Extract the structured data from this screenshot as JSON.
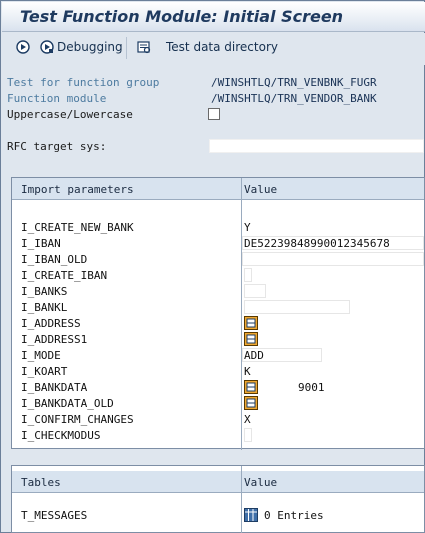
{
  "window": {
    "title": "Test Function Module: Initial Screen"
  },
  "toolbar": {
    "debugging_label": "Debugging",
    "testdata_label": "Test data directory"
  },
  "header_fields": {
    "function_group_label": "Test for function group",
    "function_group_value": "/WINSHTLQ/TRN_VENBNK_FUGR",
    "function_module_label": "Function module",
    "function_module_value": "/WINSHTLQ/TRN_VENDOR_BANK",
    "uppercase_label": "Uppercase/Lowercase",
    "rfc_label": "RFC target sys:"
  },
  "import_table": {
    "col_name": "Import parameters",
    "col_value": "Value",
    "rows": [
      {
        "name": "I_CREATE_NEW_BANK",
        "value": "Y"
      },
      {
        "name": "I_IBAN",
        "value": "DE52239848990012345678"
      },
      {
        "name": "I_IBAN_OLD",
        "value": ""
      },
      {
        "name": "I_CREATE_IBAN",
        "value": ""
      },
      {
        "name": "I_BANKS",
        "value": ""
      },
      {
        "name": "I_BANKL",
        "value": ""
      },
      {
        "name": "I_ADDRESS",
        "value": ""
      },
      {
        "name": "I_ADDRESS1",
        "value": ""
      },
      {
        "name": "I_MODE",
        "value": "ADD"
      },
      {
        "name": "I_KOART",
        "value": "K"
      },
      {
        "name": "I_BANKDATA",
        "value": "9001"
      },
      {
        "name": "I_BANKDATA_OLD",
        "value": ""
      },
      {
        "name": "I_CONFIRM_CHANGES",
        "value": "X"
      },
      {
        "name": "I_CHECKMODUS",
        "value": ""
      }
    ]
  },
  "tables_table": {
    "col_name": "Tables",
    "col_value": "Value",
    "rows": [
      {
        "name": "T_MESSAGES",
        "value": "0 Entries"
      }
    ]
  }
}
